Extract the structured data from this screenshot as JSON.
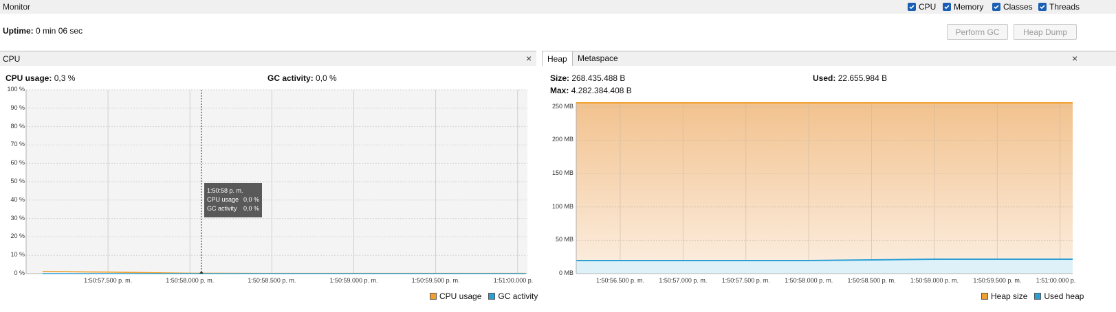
{
  "topbar": {
    "title": "Monitor",
    "checkboxes": [
      {
        "label": "CPU",
        "checked": true
      },
      {
        "label": "Memory",
        "checked": true
      },
      {
        "label": "Classes",
        "checked": true
      },
      {
        "label": "Threads",
        "checked": true
      }
    ]
  },
  "uptime": {
    "label": "Uptime:",
    "value": "0 min 06 sec"
  },
  "buttons": {
    "perform_gc": "Perform GC",
    "heap_dump": "Heap Dump"
  },
  "cpu_panel": {
    "title": "CPU",
    "close_glyph": "×",
    "cpu_usage_label": "CPU usage:",
    "cpu_usage_value": "0,3 %",
    "gc_activity_label": "GC activity:",
    "gc_activity_value": "0,0 %",
    "tooltip": {
      "time": "1:50:58 p. m.",
      "rows": [
        [
          "CPU usage",
          "0,0 %"
        ],
        [
          "GC activity",
          "0,0 %"
        ]
      ]
    },
    "legend": [
      {
        "label": "CPU usage",
        "color": "#f0a030"
      },
      {
        "label": "GC activity",
        "color": "#2a9fd6"
      }
    ]
  },
  "memory_panel": {
    "tabs": [
      {
        "label": "Heap",
        "active": true
      },
      {
        "label": "Metaspace",
        "active": false
      }
    ],
    "close_glyph": "×",
    "size_label": "Size:",
    "size_value": "268.435.488 B",
    "used_label": "Used:",
    "used_value": "22.655.984 B",
    "max_label": "Max:",
    "max_value": "4.282.384.408 B",
    "legend": [
      {
        "label": "Heap size",
        "color": "#f0a030"
      },
      {
        "label": "Used heap",
        "color": "#2a9fd6"
      }
    ]
  },
  "colors": {
    "accent": "#1a5fb4",
    "cpu": "#f0a030",
    "gc": "#2a9fd6",
    "heap_size": "#f0a030",
    "used_heap": "#2a9fd6"
  },
  "chart_data": [
    {
      "type": "line",
      "y_ticks": [
        "100 %",
        "90 %",
        "80 %",
        "70 %",
        "60 %",
        "50 %",
        "40 %",
        "30 %",
        "20 %",
        "10 %",
        "0 %"
      ],
      "x_ticks": [
        "1:50:57.500 p. m.",
        "1:50:58.000 p. m.",
        "1:50:58.500 p. m.",
        "1:50:59.000 p. m.",
        "1:50:59.500 p. m.",
        "1:51:00.000 p."
      ],
      "ylim": [
        0,
        100
      ],
      "grid": true,
      "legend_position": "bottom-right",
      "series": [
        {
          "name": "CPU usage",
          "x_sec": [
            57.1,
            57.5,
            58.0,
            58.5,
            59.0,
            59.5,
            60.05
          ],
          "values": [
            1.2,
            0.8,
            0.2,
            0.1,
            0.1,
            0.1,
            0.1
          ]
        },
        {
          "name": "GC activity",
          "x_sec": [
            57.1,
            57.5,
            58.0,
            58.5,
            59.0,
            59.5,
            60.05
          ],
          "values": [
            0,
            0,
            0,
            0,
            0,
            0,
            0
          ]
        }
      ]
    },
    {
      "type": "area",
      "y_ticks": [
        "250 MB",
        "200 MB",
        "150 MB",
        "100 MB",
        "50 MB",
        "0 MB"
      ],
      "x_ticks": [
        "1:50:56.500 p. m.",
        "1:50:57.000 p. m.",
        "1:50:57.500 p. m.",
        "1:50:58.000 p. m.",
        "1:50:58.500 p. m.",
        "1:50:59.000 p. m.",
        "1:50:59.500 p. m.",
        "1:51:00.000 p."
      ],
      "ylim": [
        0,
        256
      ],
      "grid": true,
      "legend_position": "bottom-right",
      "series": [
        {
          "name": "Heap size",
          "x_sec": [
            56.15,
            57.0,
            58.0,
            59.0,
            60.1
          ],
          "values": [
            256,
            256,
            256,
            256,
            256
          ]
        },
        {
          "name": "Used heap",
          "x_sec": [
            56.15,
            56.5,
            57.0,
            57.5,
            58.0,
            58.5,
            59.0,
            59.5,
            60.1
          ],
          "values": [
            19.5,
            19.5,
            19.5,
            19.5,
            19.5,
            20.5,
            21.6,
            21.6,
            21.6
          ]
        }
      ]
    }
  ]
}
